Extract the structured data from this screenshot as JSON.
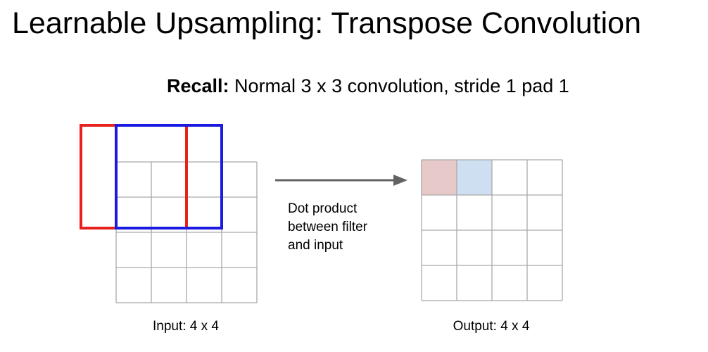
{
  "slide": {
    "title": "Learnable Upsampling: Transpose Convolution",
    "recall_label": "Recall:",
    "recall_text": " Normal 3 x 3 convolution, stride 1 pad 1"
  },
  "input_grid": {
    "rows": 4,
    "cols": 4,
    "caption": "Input: 4 x 4"
  },
  "output_grid": {
    "rows": 4,
    "cols": 4,
    "caption": "Output: 4 x 4",
    "highlighted_cells": [
      {
        "row": 0,
        "col": 0,
        "color": "#e8c9c9"
      },
      {
        "row": 0,
        "col": 1,
        "color": "#cddff0"
      }
    ]
  },
  "filters": [
    {
      "name": "red-filter",
      "color": "#e8211d",
      "start_row": -1,
      "start_col": -1,
      "size": 3
    },
    {
      "name": "blue-filter",
      "color": "#1a1ae0",
      "start_row": -1,
      "start_col": 0,
      "size": 3
    }
  ],
  "arrow": {
    "color": "#636363",
    "label_lines": [
      "Dot product",
      "between filter",
      "and input"
    ]
  },
  "colors": {
    "grid": "#a9a9a9",
    "text": "#000000"
  }
}
